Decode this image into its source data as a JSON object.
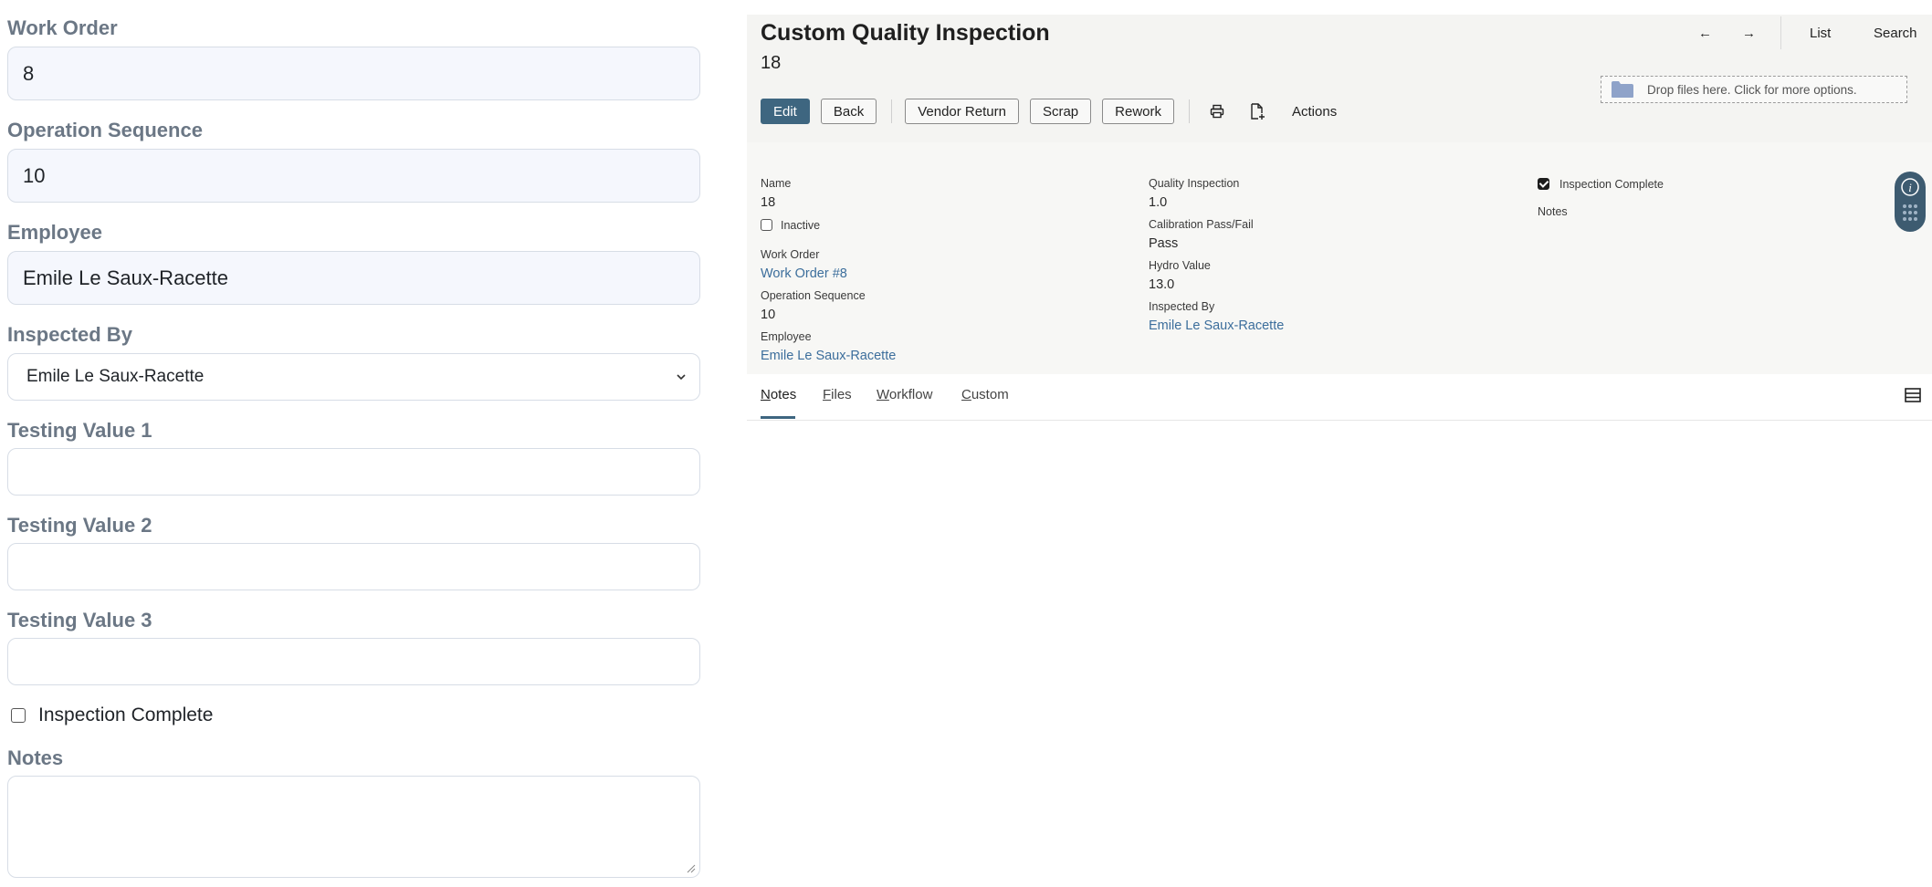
{
  "left_form": {
    "work_order": {
      "label": "Work Order",
      "value": "8"
    },
    "operation_sequence": {
      "label": "Operation Sequence",
      "value": "10"
    },
    "employee": {
      "label": "Employee",
      "value": "Emile Le Saux-Racette"
    },
    "inspected_by": {
      "label": "Inspected By",
      "value": "Emile Le Saux-Racette"
    },
    "testing_value_1": {
      "label": "Testing Value 1",
      "value": ""
    },
    "testing_value_2": {
      "label": "Testing Value 2",
      "value": ""
    },
    "testing_value_3": {
      "label": "Testing Value 3",
      "value": ""
    },
    "inspection_complete": {
      "label": "Inspection Complete",
      "checked": false
    },
    "notes": {
      "label": "Notes",
      "value": ""
    }
  },
  "record": {
    "title": "Custom Quality Inspection",
    "subtitle": "18",
    "nav": {
      "prev_icon": "arrow-left-icon",
      "next_icon": "arrow-right-icon",
      "prev": "←",
      "next": "→",
      "list": "List",
      "search": "Search"
    },
    "buttons": {
      "edit": "Edit",
      "back": "Back",
      "vendor_return": "Vendor Return",
      "scrap": "Scrap",
      "rework": "Rework",
      "actions": "Actions"
    },
    "dropzone": "Drop files here. Click for more options.",
    "fields": {
      "name": {
        "label": "Name",
        "value": "18"
      },
      "inactive": {
        "label": "Inactive",
        "checked": false
      },
      "work_order": {
        "label": "Work Order",
        "value": "Work Order #8"
      },
      "operation_sequence": {
        "label": "Operation Sequence",
        "value": "10"
      },
      "employee": {
        "label": "Employee",
        "value": "Emile Le Saux-Racette"
      },
      "quality_inspection": {
        "label": "Quality Inspection",
        "value": "1.0"
      },
      "calibration": {
        "label": "Calibration Pass/Fail",
        "value": "Pass"
      },
      "hydro_value": {
        "label": "Hydro Value",
        "value": "13.0"
      },
      "inspected_by": {
        "label": "Inspected By",
        "value": "Emile Le Saux-Racette"
      },
      "inspection_complete": {
        "label": "Inspection Complete",
        "checked": true
      },
      "notes": {
        "label": "Notes"
      }
    },
    "tabs": [
      {
        "first": "N",
        "rest": "otes",
        "active": true
      },
      {
        "first": "F",
        "rest": "iles",
        "active": false
      },
      {
        "first": "W",
        "rest": "orkflow",
        "active": false
      },
      {
        "first": "C",
        "rest": "ustom",
        "active": false
      }
    ]
  },
  "colors": {
    "accent": "#3e6680",
    "link": "#3c6e9c",
    "label_gray": "#6b7785",
    "side_pill": "#3d5b70"
  }
}
